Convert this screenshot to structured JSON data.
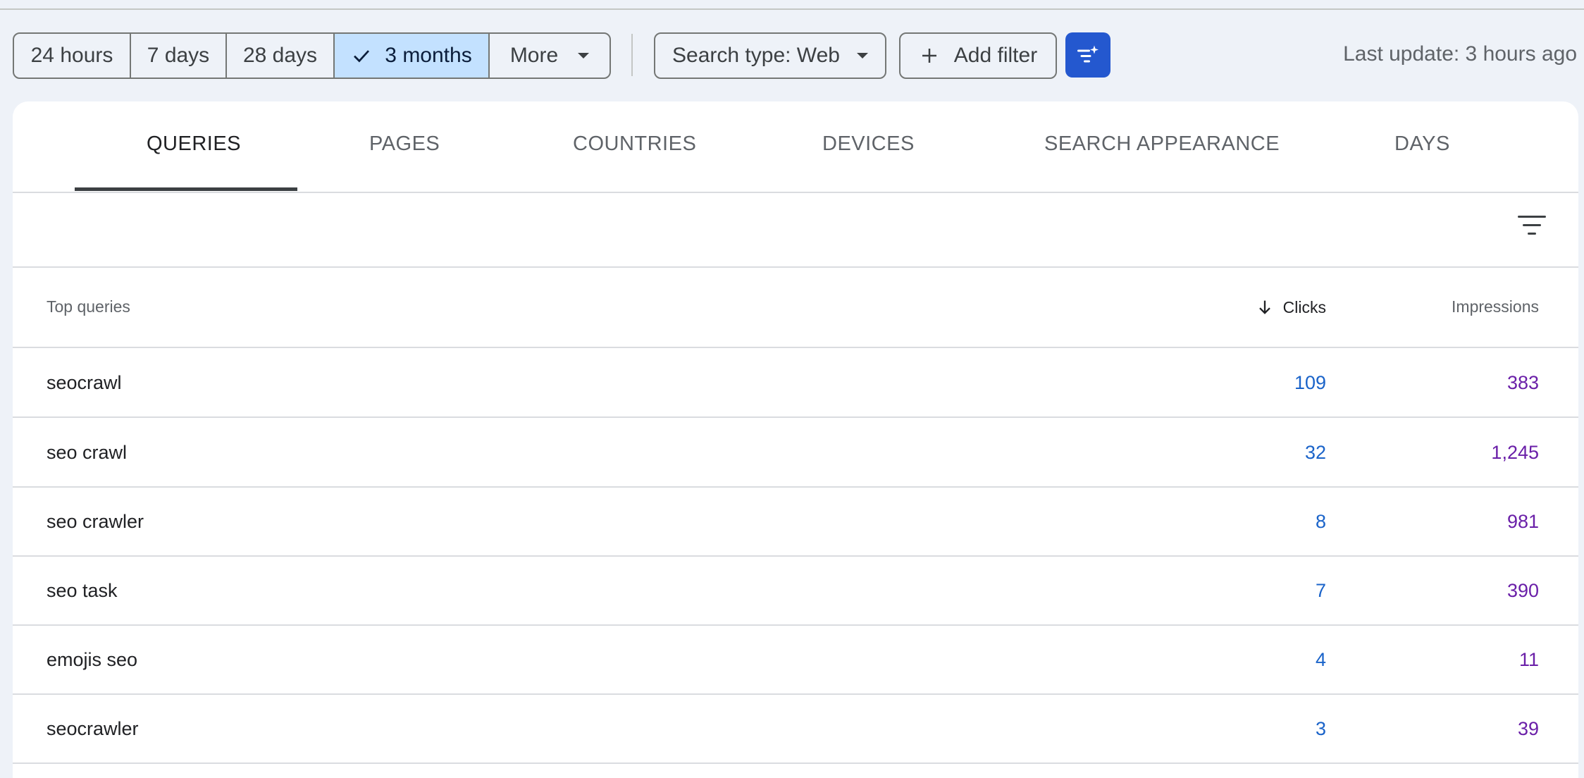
{
  "toolbar": {
    "ranges": [
      "24 hours",
      "7 days",
      "28 days",
      "3 months"
    ],
    "selected_range": "3 months",
    "more_label": "More",
    "search_type_label": "Search type: Web",
    "add_filter_label": "Add filter",
    "last_update": "Last update: 3 hours ago"
  },
  "tabs": [
    "QUERIES",
    "PAGES",
    "COUNTRIES",
    "DEVICES",
    "SEARCH APPEARANCE",
    "DAYS"
  ],
  "active_tab": "QUERIES",
  "table": {
    "headers": {
      "query": "Top queries",
      "clicks": "Clicks",
      "impressions": "Impressions"
    },
    "sort": "Clicks descending",
    "rows": [
      {
        "query": "seocrawl",
        "clicks": "109",
        "impressions": "383"
      },
      {
        "query": "seo crawl",
        "clicks": "32",
        "impressions": "1,245"
      },
      {
        "query": "seo crawler",
        "clicks": "8",
        "impressions": "981"
      },
      {
        "query": "seo task",
        "clicks": "7",
        "impressions": "390"
      },
      {
        "query": "emojis seo",
        "clicks": "4",
        "impressions": "11"
      },
      {
        "query": "seocrawler",
        "clicks": "3",
        "impressions": "39"
      }
    ]
  },
  "colors": {
    "selected_bg": "#c3e1ff",
    "accent_button": "#2458cf",
    "clicks_text": "#1a63c9",
    "impressions_text": "#6a1fa8"
  },
  "icons": [
    "check-icon",
    "dropdown-caret-icon",
    "plus-icon",
    "filter-sparkle-icon",
    "filter-list-icon",
    "sort-arrow-down-icon"
  ]
}
